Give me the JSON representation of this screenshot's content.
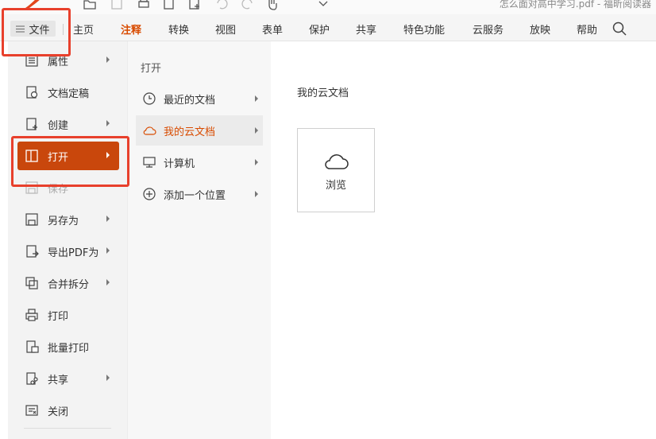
{
  "window": {
    "title": "怎么面对高中学习.pdf - 福昕阅读器"
  },
  "ribbon": {
    "file_label": "文件",
    "tabs": [
      {
        "label": "主页"
      },
      {
        "label": "注释",
        "active": true
      },
      {
        "label": "转换"
      },
      {
        "label": "视图"
      },
      {
        "label": "表单"
      },
      {
        "label": "保护"
      },
      {
        "label": "共享"
      },
      {
        "label": "特色功能"
      },
      {
        "label": "云服务"
      },
      {
        "label": "放映"
      },
      {
        "label": "帮助"
      }
    ]
  },
  "file_menu": {
    "items": [
      {
        "label": "属性",
        "icon": "properties-icon"
      },
      {
        "label": "文档定稿",
        "icon": "finalize-doc-icon"
      },
      {
        "label": "创建",
        "icon": "create-icon"
      },
      {
        "label": "打开",
        "icon": "open-icon",
        "selected": true
      },
      {
        "label": "保存",
        "icon": "save-icon",
        "disabled": true
      },
      {
        "label": "另存为",
        "icon": "save-as-icon"
      },
      {
        "label": "导出PDF为",
        "icon": "export-pdf-icon"
      },
      {
        "label": "合并拆分",
        "icon": "merge-split-icon"
      },
      {
        "label": "打印",
        "icon": "print-icon"
      },
      {
        "label": "批量打印",
        "icon": "batch-print-icon"
      },
      {
        "label": "共享",
        "icon": "share-icon"
      },
      {
        "label": "关闭",
        "icon": "close-doc-icon"
      }
    ]
  },
  "open_submenu": {
    "heading": "打开",
    "items": [
      {
        "label": "最近的文档",
        "icon": "clock-icon"
      },
      {
        "label": "我的云文档",
        "icon": "cloud-icon",
        "selected": true
      },
      {
        "label": "计算机",
        "icon": "computer-icon"
      },
      {
        "label": "添加一个位置",
        "icon": "plus-circle-icon"
      }
    ]
  },
  "cloud_panel": {
    "title": "我的云文档",
    "browse_label": "浏览"
  },
  "colors": {
    "accent": "#c9470c",
    "active_tab": "#d84b00",
    "highlight_box": "#e8402c"
  }
}
